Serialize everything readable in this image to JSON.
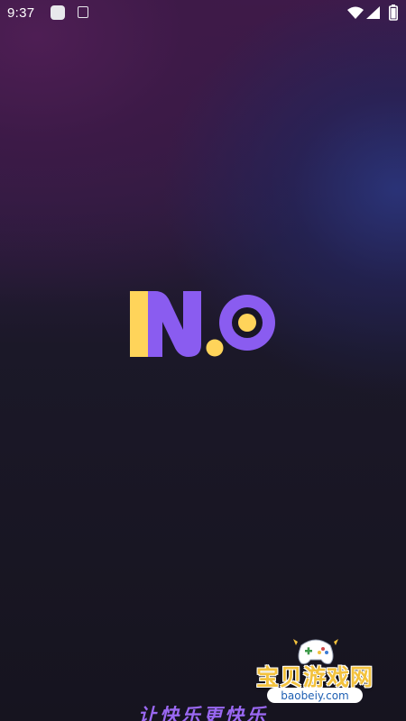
{
  "status_bar": {
    "time": "9:37",
    "icons": [
      "app-notification-icon",
      "a-notification-icon",
      "wifi-icon",
      "signal-icon",
      "battery-icon"
    ]
  },
  "logo": {
    "text": "N.O",
    "colors": {
      "n_left_bar": "#ffd45a",
      "n_body": "#8a5cf0",
      "dot": "#ffd45a",
      "o_ring": "#8a5cf0",
      "o_center": "#ffd45a"
    }
  },
  "slogan": "让快乐更快乐",
  "watermark": {
    "title": "宝贝游戏网",
    "url": "baobeiy.com",
    "mascot_icon": "gamepad-mascot-icon"
  },
  "colors": {
    "background_top": "#3f1a4a",
    "background_glow": "#2a347a",
    "background_bottom": "#16141f",
    "slogan": "#9a68f2",
    "watermark_title": "#f3c23d"
  }
}
